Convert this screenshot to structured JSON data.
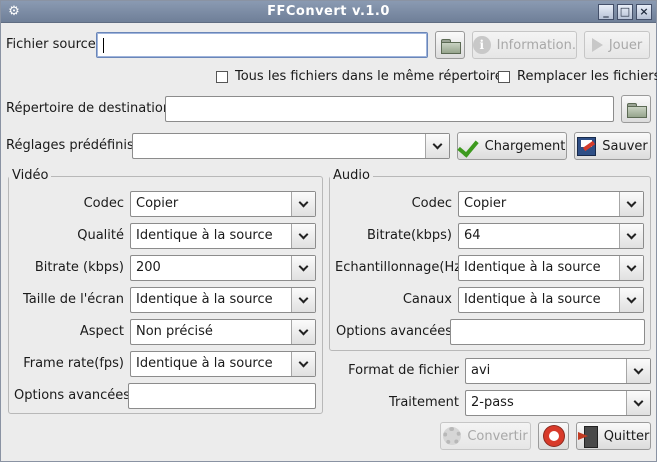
{
  "window": {
    "title": "FFConvert v.1.0",
    "app_icon": "gear-wrench-icon",
    "min": "_",
    "max": "□",
    "close": "×"
  },
  "source": {
    "label": "Fichier source",
    "value": ""
  },
  "buttons": {
    "information": "Information.",
    "jouer": "Jouer",
    "chargement": "Chargement",
    "sauver": "Sauver",
    "convertir": "Convertir",
    "quitter": "Quitter"
  },
  "options": {
    "same_dir": "Tous les fichiers dans le même répertoire",
    "replace": "Remplacer les fichiers"
  },
  "destination": {
    "label": "Répertoire de destination",
    "value": ""
  },
  "presets": {
    "label": "Réglages prédéfinis",
    "value": ""
  },
  "video": {
    "title": "Vidéo",
    "codec_label": "Codec",
    "codec": "Copier",
    "qualite_label": "Qualité",
    "qualite": "Identique à la source",
    "bitrate_label": "Bitrate (kbps)",
    "bitrate": "200",
    "taille_label": "Taille de l'écran",
    "taille": "Identique à la source",
    "aspect_label": "Aspect",
    "aspect": "Non précisé",
    "framerate_label": "Frame rate(fps)",
    "framerate": "Identique à la source",
    "avancees_label": "Options avancées",
    "avancees": ""
  },
  "audio": {
    "title": "Audio",
    "codec_label": "Codec",
    "codec": "Copier",
    "bitrate_label": "Bitrate(kbps)",
    "bitrate": "64",
    "echant_label": "Echantillonnage(Hz)",
    "echant": "Identique à la source",
    "canaux_label": "Canaux",
    "canaux": "Identique à la source",
    "avancees_label": "Options avancées",
    "avancees": ""
  },
  "format": {
    "label": "Format de fichier",
    "value": "avi"
  },
  "traitement": {
    "label": "Traitement",
    "value": "2-pass"
  }
}
